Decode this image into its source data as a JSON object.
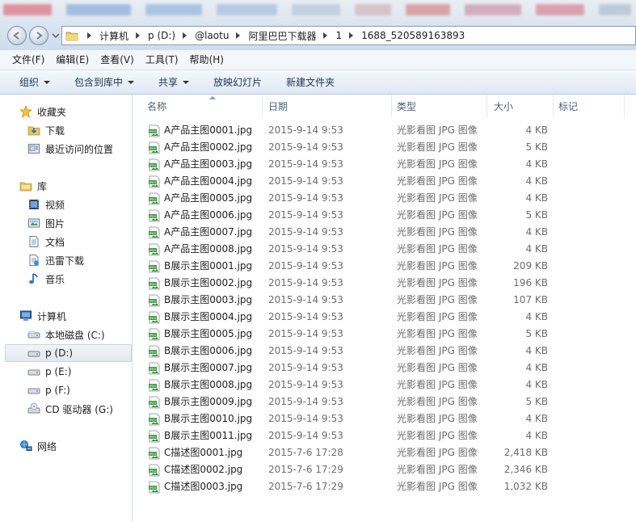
{
  "taskbar_blur": [
    {
      "w": 60,
      "c": "#d94b5f"
    },
    {
      "w": 80,
      "c": "#6b9bd6"
    },
    {
      "w": 70,
      "c": "#7aa6d8"
    },
    {
      "w": 75,
      "c": "#8fb0d6"
    },
    {
      "w": 60,
      "c": "#a9bcd4"
    },
    {
      "w": 45,
      "c": "#c9a3ad"
    },
    {
      "w": 55,
      "c": "#d36b6b"
    },
    {
      "w": 70,
      "c": "#c77a9a"
    },
    {
      "w": 60,
      "c": "#d5667a"
    },
    {
      "w": 40,
      "c": "#9fb0c6"
    }
  ],
  "address": {
    "crumbs": [
      "计算机",
      "p (D:)",
      "@laotu",
      "阿里巴巴下载器",
      "1",
      "1688_520589163893"
    ]
  },
  "menu": [
    "文件(F)",
    "编辑(E)",
    "查看(V)",
    "工具(T)",
    "帮助(H)"
  ],
  "toolbar": {
    "organize": "组织",
    "include_library": "包含到库中",
    "share": "共享",
    "slideshow": "放映幻灯片",
    "new_folder": "新建文件夹"
  },
  "nav": {
    "favorites": {
      "label": "收藏夹",
      "items": [
        "下载",
        "最近访问的位置"
      ]
    },
    "libraries": {
      "label": "库",
      "items": [
        "视频",
        "图片",
        "文档",
        "迅雷下载",
        "音乐"
      ]
    },
    "computer": {
      "label": "计算机",
      "items": [
        "本地磁盘 (C:)",
        "p (D:)",
        "p (E:)",
        "p (F:)",
        "CD 驱动器 (G:)"
      ]
    },
    "network": {
      "label": "网络"
    }
  },
  "columns": {
    "name": "名称",
    "date": "日期",
    "type": "类型",
    "size": "大小",
    "tags": "标记"
  },
  "files": [
    {
      "name": "A产品主图0001.jpg",
      "date": "2015-9-14 9:53",
      "type": "光影看图 JPG 图像",
      "size": "4 KB"
    },
    {
      "name": "A产品主图0002.jpg",
      "date": "2015-9-14 9:53",
      "type": "光影看图 JPG 图像",
      "size": "5 KB"
    },
    {
      "name": "A产品主图0003.jpg",
      "date": "2015-9-14 9:53",
      "type": "光影看图 JPG 图像",
      "size": "4 KB"
    },
    {
      "name": "A产品主图0004.jpg",
      "date": "2015-9-14 9:53",
      "type": "光影看图 JPG 图像",
      "size": "4 KB"
    },
    {
      "name": "A产品主图0005.jpg",
      "date": "2015-9-14 9:53",
      "type": "光影看图 JPG 图像",
      "size": "4 KB"
    },
    {
      "name": "A产品主图0006.jpg",
      "date": "2015-9-14 9:53",
      "type": "光影看图 JPG 图像",
      "size": "5 KB"
    },
    {
      "name": "A产品主图0007.jpg",
      "date": "2015-9-14 9:53",
      "type": "光影看图 JPG 图像",
      "size": "4 KB"
    },
    {
      "name": "A产品主图0008.jpg",
      "date": "2015-9-14 9:53",
      "type": "光影看图 JPG 图像",
      "size": "4 KB"
    },
    {
      "name": "B展示主图0001.jpg",
      "date": "2015-9-14 9:53",
      "type": "光影看图 JPG 图像",
      "size": "209 KB"
    },
    {
      "name": "B展示主图0002.jpg",
      "date": "2015-9-14 9:53",
      "type": "光影看图 JPG 图像",
      "size": "196 KB"
    },
    {
      "name": "B展示主图0003.jpg",
      "date": "2015-9-14 9:53",
      "type": "光影看图 JPG 图像",
      "size": "107 KB"
    },
    {
      "name": "B展示主图0004.jpg",
      "date": "2015-9-14 9:53",
      "type": "光影看图 JPG 图像",
      "size": "4 KB"
    },
    {
      "name": "B展示主图0005.jpg",
      "date": "2015-9-14 9:53",
      "type": "光影看图 JPG 图像",
      "size": "5 KB"
    },
    {
      "name": "B展示主图0006.jpg",
      "date": "2015-9-14 9:53",
      "type": "光影看图 JPG 图像",
      "size": "4 KB"
    },
    {
      "name": "B展示主图0007.jpg",
      "date": "2015-9-14 9:53",
      "type": "光影看图 JPG 图像",
      "size": "4 KB"
    },
    {
      "name": "B展示主图0008.jpg",
      "date": "2015-9-14 9:53",
      "type": "光影看图 JPG 图像",
      "size": "4 KB"
    },
    {
      "name": "B展示主图0009.jpg",
      "date": "2015-9-14 9:53",
      "type": "光影看图 JPG 图像",
      "size": "5 KB"
    },
    {
      "name": "B展示主图0010.jpg",
      "date": "2015-9-14 9:53",
      "type": "光影看图 JPG 图像",
      "size": "4 KB"
    },
    {
      "name": "B展示主图0011.jpg",
      "date": "2015-9-14 9:53",
      "type": "光影看图 JPG 图像",
      "size": "4 KB"
    },
    {
      "name": "C描述图0001.jpg",
      "date": "2015-7-6 17:28",
      "type": "光影看图 JPG 图像",
      "size": "2,418 KB"
    },
    {
      "name": "C描述图0002.jpg",
      "date": "2015-7-6 17:29",
      "type": "光影看图 JPG 图像",
      "size": "2,346 KB"
    },
    {
      "name": "C描述图0003.jpg",
      "date": "2015-7-6 17:29",
      "type": "光影看图 JPG 图像",
      "size": "1,032 KB"
    }
  ],
  "icons": {
    "file": "jpeg-file-icon",
    "back": "back-arrow-icon",
    "forward": "forward-arrow-icon"
  }
}
